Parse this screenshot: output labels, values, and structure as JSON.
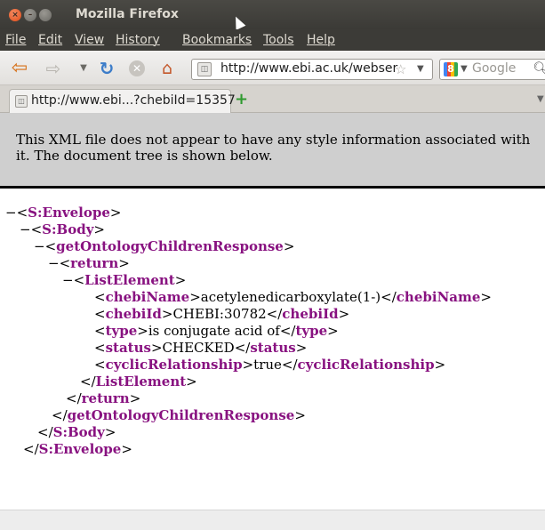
{
  "window": {
    "title": "Mozilla Firefox"
  },
  "menu": [
    "File",
    "Edit",
    "View",
    "History",
    "Bookmarks",
    "Tools",
    "Help"
  ],
  "navbar": {
    "url": "http://www.ebi.ac.uk/webser",
    "search_placeholder": "Google",
    "icons": {
      "back": "back-arrow",
      "forward": "forward-arrow",
      "reload": "reload",
      "stop": "stop",
      "home": "home"
    }
  },
  "tab": {
    "title": "http://www.ebi...?chebiId=15357",
    "new_tab_label": "+"
  },
  "notice": "This XML file does not appear to have any style information associated with it. The document tree is shown below.",
  "xml": {
    "envelope": "S:Envelope",
    "body": "S:Body",
    "response": "getOntologyChildrenResponse",
    "return": "return",
    "list_element": "ListElement",
    "fields": [
      {
        "tag": "chebiName",
        "value": "acetylenedicarboxylate(1-)"
      },
      {
        "tag": "chebiId",
        "value": "CHEBI:30782"
      },
      {
        "tag": "type",
        "value": "is conjugate acid of"
      },
      {
        "tag": "status",
        "value": "CHECKED"
      },
      {
        "tag": "cyclicRelationship",
        "value": "true"
      }
    ]
  },
  "colors": {
    "tag": "#881280",
    "titlebar": "#3c3b37",
    "accent": "#d66f16"
  }
}
